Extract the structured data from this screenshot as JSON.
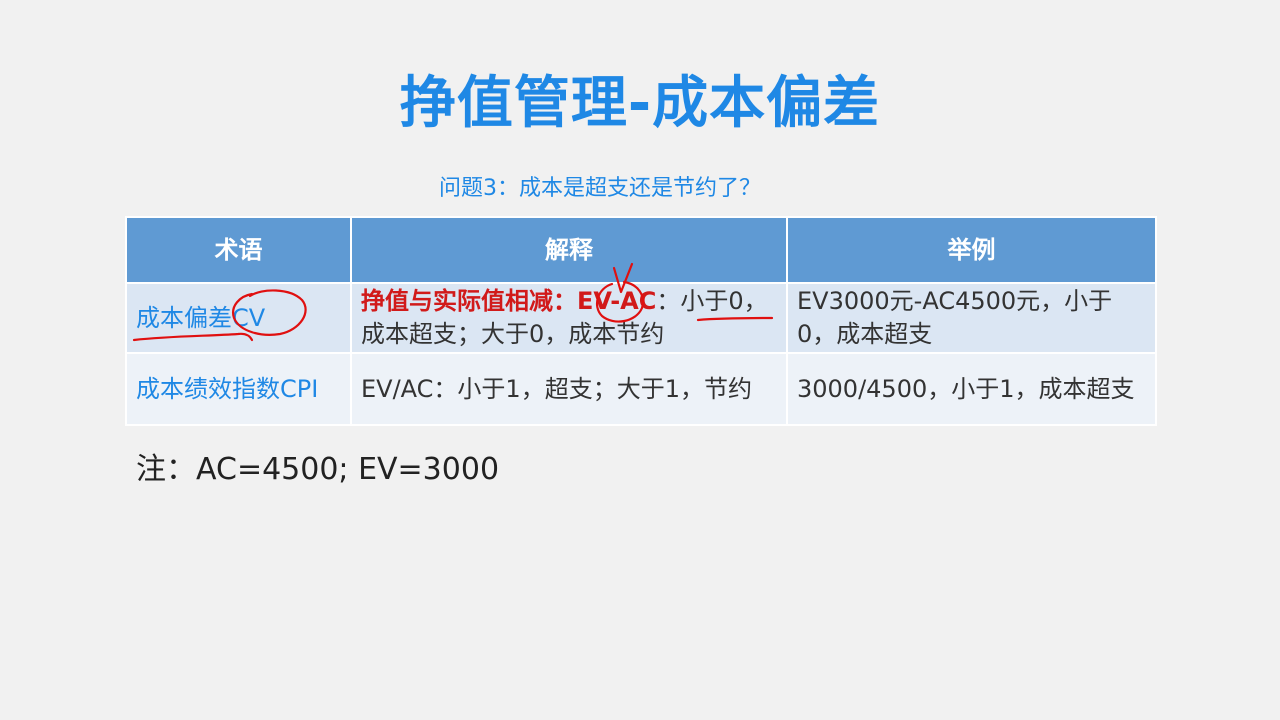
{
  "title": "挣值管理-成本偏差",
  "question": "问题3：成本是超支还是节约了？",
  "table": {
    "headers": [
      "术语",
      "解释",
      "举例"
    ],
    "rows": [
      {
        "term": "成本偏差CV",
        "explanation_lead": "挣值与实际值相减：EV-AC",
        "explanation_rest": "：小于0，成本超支；大于0，成本节约",
        "example": "EV3000元-AC4500元，小于0，成本超支"
      },
      {
        "term": "成本绩效指数CPI",
        "explanation": "EV/AC：小于1，超支；大于1，节约",
        "example": "3000/4500，小于1，成本超支"
      }
    ]
  },
  "note": "注：AC=4500; EV=3000",
  "colors": {
    "title": "#1f88e5",
    "header_bg": "#5f9ad3",
    "row1_bg": "#dbe6f3",
    "row2_bg": "#edf2f8",
    "highlight": "#d11a1a",
    "annotation": "#e01010"
  }
}
